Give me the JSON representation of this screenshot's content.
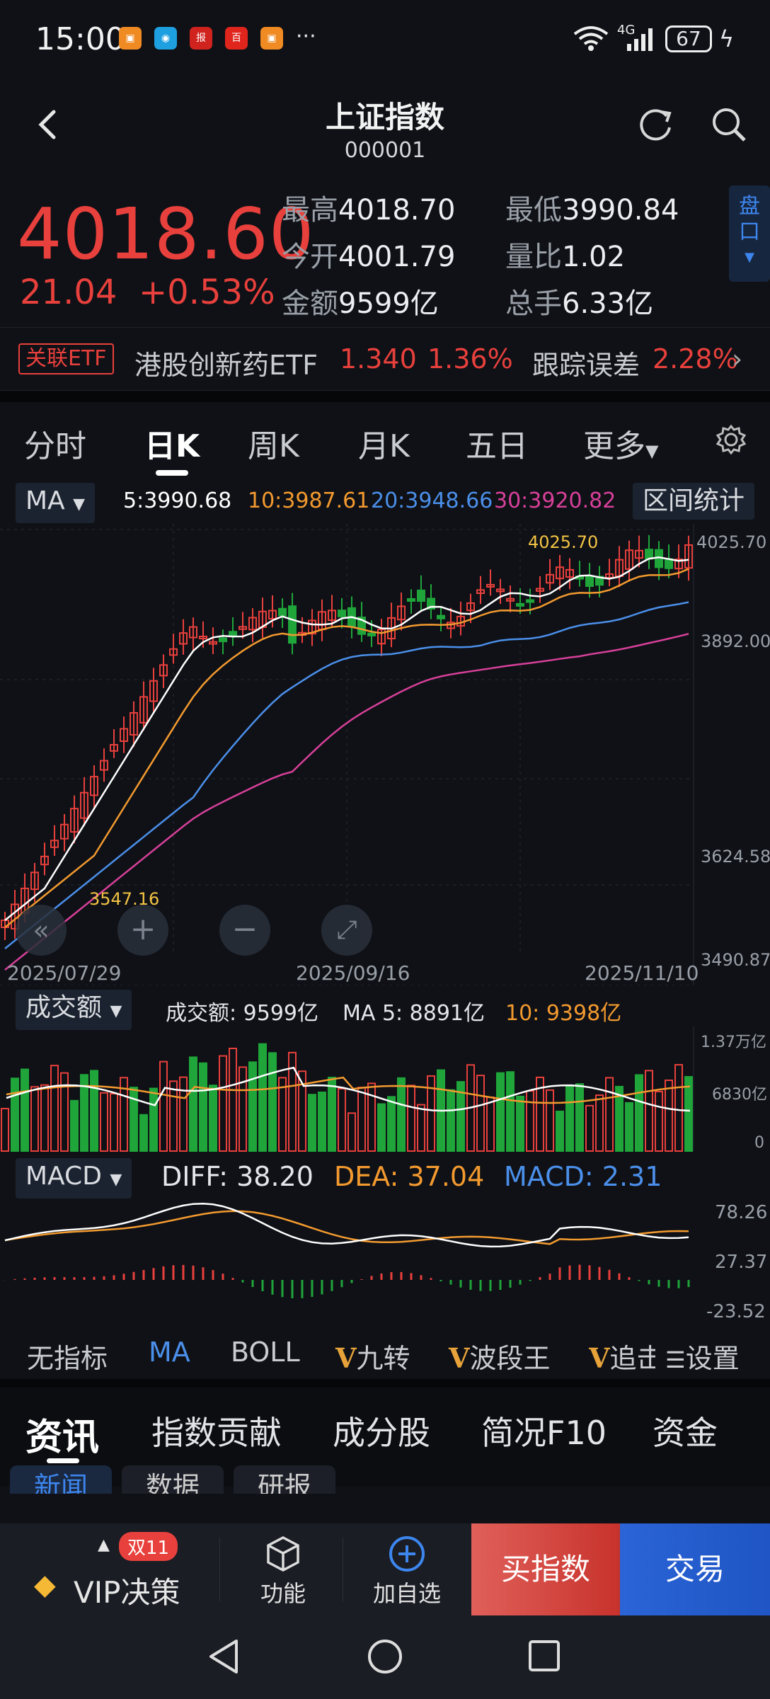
{
  "status_bar": {
    "time": "15:00",
    "network": "4G",
    "battery": "67",
    "more": "···"
  },
  "header": {
    "title": "上证指数",
    "code": "000001"
  },
  "quote": {
    "price": "4018.60",
    "change": "21.04",
    "change_pct": "+0.53%",
    "stats": [
      {
        "label": "最高",
        "value": "4018.70"
      },
      {
        "label": "最低",
        "value": "3990.84"
      },
      {
        "label": "今开",
        "value": "4001.79"
      },
      {
        "label": "量比",
        "value": "1.02"
      },
      {
        "label": "金额",
        "value": "9599亿"
      },
      {
        "label": "总手",
        "value": "6.33亿"
      }
    ],
    "pankou": [
      "盘",
      "口"
    ]
  },
  "etf": {
    "tag": "关联ETF",
    "name": "港股创新药ETF",
    "price": "1.340",
    "pct": "1.36%",
    "track_label": "跟踪误差",
    "track_value": "2.28%"
  },
  "tabs": [
    "分时",
    "日K",
    "周K",
    "月K",
    "五日",
    "更多"
  ],
  "active_tab": "日K",
  "ma_bar": {
    "selector": "MA",
    "ma5": "5:3990.68",
    "ma10": "10:3987.61",
    "ma20": "20:3948.66",
    "ma30": "30:3920.82",
    "range_stats": "区间统计"
  },
  "price_axis": [
    "4025.70",
    "3892.00",
    "3624.58",
    "3490.87"
  ],
  "high_label": "4025.70",
  "low_label": "3547.16",
  "dates": [
    "2025/07/29",
    "2025/09/16",
    "2025/11/10"
  ],
  "volume": {
    "selector": "成交额",
    "text": "成交额: 9599亿",
    "ma5": "MA 5: 8891亿",
    "ma10": "10: 9398亿",
    "axis": [
      "1.37万亿",
      "6830亿",
      "0"
    ]
  },
  "macd": {
    "selector": "MACD",
    "diff": "DIFF: 38.20",
    "dea": "DEA: 37.04",
    "macd": "MACD: 2.31",
    "axis": [
      "78.26",
      "27.37",
      "-23.52"
    ]
  },
  "indicator_tabs": [
    "无指标",
    "MA",
    "BOLL",
    "九转",
    "波段王",
    "追击",
    "设置"
  ],
  "section_tabs": [
    "资讯",
    "指数贡献",
    "成分股",
    "简况F10",
    "资金"
  ],
  "sub_tabs": [
    "新闻",
    "数据",
    "研报"
  ],
  "bottom": {
    "vip": "VIP决策",
    "badge": "双11",
    "func": "功能",
    "add": "加自选",
    "buy": "买指数",
    "trade": "交易"
  },
  "colors": {
    "up": "#e8403c",
    "down": "#1fa53a",
    "ma5": "#ffffff",
    "ma10": "#f39a2f",
    "ma20": "#4b8fea",
    "ma30": "#d8409a"
  }
}
